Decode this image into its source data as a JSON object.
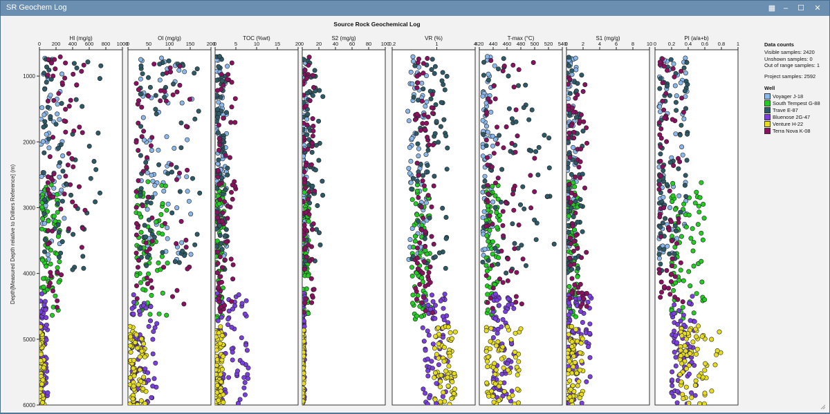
{
  "window": {
    "title": "SR Geochem Log"
  },
  "controls": {
    "layout_icon": "▦",
    "minimize": "‒",
    "maximize": "☐",
    "close": "✕"
  },
  "chart_data": {
    "type": "scatter",
    "title": "Source Rock Geochemical Log",
    "ylabel": "Depth[Measured Depth relative to Drillers Reference] (m)",
    "ylim": [
      6000,
      600
    ],
    "y_ticks": [
      1000,
      2000,
      3000,
      4000,
      5000,
      6000
    ],
    "y_tick_labels": [
      "1000",
      "2000",
      "3000",
      "4000",
      "5000",
      "6000"
    ],
    "tracks": [
      {
        "label": "HI (mg/g)",
        "xlim": [
          0,
          1000
        ],
        "ticks": [
          0,
          200,
          400,
          600,
          800,
          1000
        ],
        "tick_labels": [
          "0",
          "200",
          "400",
          "600",
          "800",
          "1000"
        ],
        "scale": "linear"
      },
      {
        "label": "OI (mg/g)",
        "xlim": [
          0,
          200
        ],
        "ticks": [
          0,
          50,
          100,
          150,
          200
        ],
        "tick_labels": [
          "0",
          "50",
          "100",
          "150",
          "200"
        ],
        "scale": "linear"
      },
      {
        "label": "TOC (%wt)",
        "xlim": [
          0,
          20
        ],
        "ticks": [
          0,
          5,
          10,
          15,
          20
        ],
        "tick_labels": [
          "0",
          "5",
          "10",
          "15",
          "20"
        ],
        "scale": "linear"
      },
      {
        "label": "S2 (mg/g)",
        "xlim": [
          0,
          100
        ],
        "ticks": [
          0,
          20,
          40,
          60,
          80,
          100
        ],
        "tick_labels": [
          "0",
          "20",
          "40",
          "60",
          "80",
          "100"
        ],
        "scale": "linear"
      },
      {
        "label": "VR (%)",
        "xlim": [
          0.2,
          4
        ],
        "ticks": [
          0.2,
          1,
          4
        ],
        "tick_labels": [
          "0.2",
          "1",
          "4"
        ],
        "scale": "log"
      },
      {
        "label": "T-max (°C)",
        "xlim": [
          420,
          540
        ],
        "ticks": [
          420,
          440,
          460,
          480,
          500,
          520,
          540
        ],
        "tick_labels": [
          "420",
          "440",
          "460",
          "480",
          "500",
          "520",
          "540"
        ],
        "scale": "linear"
      },
      {
        "label": "S1 (mg/g)",
        "xlim": [
          0,
          10
        ],
        "ticks": [
          0,
          2,
          4,
          6,
          8,
          10
        ],
        "tick_labels": [
          "0",
          "2",
          "4",
          "6",
          "8",
          "10"
        ],
        "scale": "linear"
      },
      {
        "label": "PI (a/a+b)",
        "xlim": [
          0,
          1
        ],
        "ticks": [
          0,
          0.2,
          0.4,
          0.6,
          0.8,
          1
        ],
        "tick_labels": [
          "0",
          "0.2",
          "0.4",
          "0.6",
          "0.8",
          "1"
        ],
        "scale": "linear"
      }
    ],
    "wells": [
      {
        "name": "Voyager J-18",
        "color": "#8bb8ea",
        "depth_range": [
          700,
          3800
        ],
        "hi": [
          20,
          300
        ],
        "oi": [
          30,
          160
        ],
        "toc": [
          0.3,
          3
        ],
        "s2": [
          0.3,
          6
        ],
        "vr": [
          0.35,
          0.7
        ],
        "tmax": [
          425,
          445
        ],
        "s1": [
          0.1,
          1.2
        ],
        "pi": [
          0.05,
          0.4
        ]
      },
      {
        "name": "South Tempest G-88",
        "color": "#22cc22",
        "depth_range": [
          2600,
          4700
        ],
        "hi": [
          30,
          250
        ],
        "oi": [
          20,
          100
        ],
        "toc": [
          0.3,
          2.5
        ],
        "s2": [
          0.5,
          8
        ],
        "vr": [
          0.4,
          0.8
        ],
        "tmax": [
          430,
          450
        ],
        "s1": [
          0.2,
          1.5
        ],
        "pi": [
          0.2,
          0.6
        ]
      },
      {
        "name": "Trave E-87",
        "color": "#2d5a66",
        "depth_range": [
          700,
          4000
        ],
        "hi": [
          50,
          750
        ],
        "oi": [
          30,
          180
        ],
        "toc": [
          0.3,
          3
        ],
        "s2": [
          0.5,
          25
        ],
        "vr": [
          0.4,
          1.5
        ],
        "tmax": [
          425,
          530
        ],
        "s1": [
          0.1,
          2
        ],
        "pi": [
          0.05,
          0.4
        ]
      },
      {
        "name": "Bluenose 2G-47",
        "color": "#7a3fdc",
        "depth_range": [
          4300,
          6000
        ],
        "hi": [
          10,
          100
        ],
        "oi": [
          10,
          70
        ],
        "toc": [
          0.5,
          8
        ],
        "s2": [
          0.2,
          3
        ],
        "vr": [
          0.6,
          1.5
        ],
        "tmax": [
          440,
          470
        ],
        "s1": [
          0.2,
          3
        ],
        "pi": [
          0.2,
          0.5
        ]
      },
      {
        "name": "Venture H-22",
        "color": "#e6dc1e",
        "depth_range": [
          4800,
          6000
        ],
        "hi": [
          5,
          60
        ],
        "oi": [
          5,
          50
        ],
        "toc": [
          0.2,
          2
        ],
        "s2": [
          0.1,
          2
        ],
        "vr": [
          0.9,
          2.0
        ],
        "tmax": [
          430,
          480
        ],
        "s1": [
          0.1,
          2
        ],
        "pi": [
          0.3,
          0.8
        ]
      },
      {
        "name": "Terra Nova K-08",
        "color": "#8a1060",
        "depth_range": [
          700,
          4600
        ],
        "hi": [
          100,
          600
        ],
        "oi": [
          20,
          150
        ],
        "toc": [
          0.5,
          5
        ],
        "s2": [
          1,
          15
        ],
        "vr": [
          0.45,
          0.9
        ],
        "tmax": [
          430,
          500
        ],
        "s1": [
          0.2,
          2.5
        ],
        "pi": [
          0.05,
          0.35
        ]
      }
    ]
  },
  "data_counts": {
    "header": "Data counts",
    "visible": "Visible samples: 2420",
    "unshown": "Unshown samples: 0",
    "out_of_range": "Out of range samples: 1",
    "project": "Project samples: 2592"
  },
  "legend": {
    "header": "Well"
  }
}
